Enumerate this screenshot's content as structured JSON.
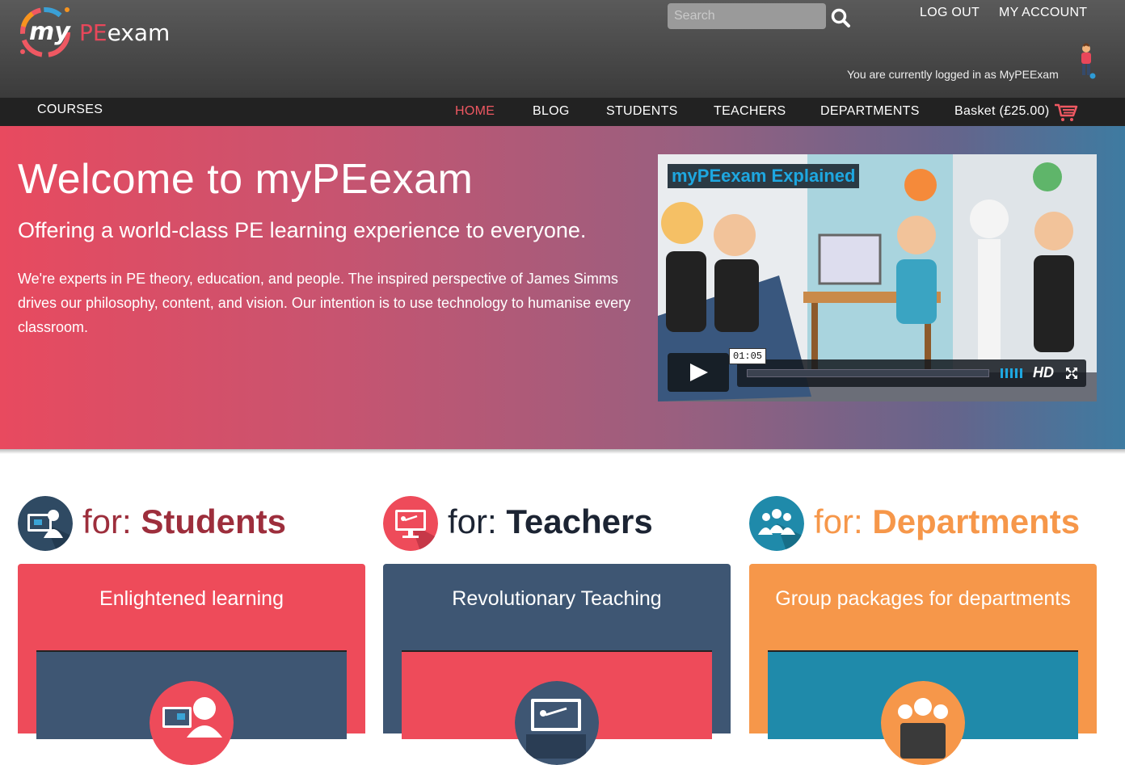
{
  "header": {
    "logo_my": "my",
    "logo_pe": "PE",
    "logo_exam": "exam",
    "search_placeholder": "Search",
    "logout": "LOG OUT",
    "my_account": "MY ACCOUNT",
    "logged_in_text": "You are currently logged in as MyPEExam"
  },
  "nav": {
    "courses": "COURSES",
    "items": [
      {
        "label": "HOME",
        "active": true
      },
      {
        "label": "BLOG"
      },
      {
        "label": "STUDENTS"
      },
      {
        "label": "TEACHERS"
      },
      {
        "label": "DEPARTMENTS"
      }
    ],
    "basket": "Basket (£25.00)"
  },
  "hero": {
    "title": "Welcome to myPEexam",
    "subtitle": "Offering a world-class PE learning experience to everyone.",
    "body": "We're experts in PE theory, education, and people. The inspired perspective of James Simms drives our philosophy, content, and vision. Our intention is to use technology to humanise every classroom.",
    "video": {
      "title": "myPEexam Explained",
      "time": "01:05",
      "progress": 0,
      "hd": "HD"
    }
  },
  "audiences": [
    {
      "for": "for:",
      "who": "Students",
      "card_title": "Enlightened learning"
    },
    {
      "for": "for:",
      "who": "Teachers",
      "card_title": "Revolutionary Teaching"
    },
    {
      "for": "for:",
      "who": "Departments",
      "card_title": "Group packages for departments"
    }
  ],
  "colors": {
    "accent_red": "#ee4b5a",
    "slate": "#3e5673",
    "orange": "#f6974a",
    "teal": "#1f8aaa"
  }
}
